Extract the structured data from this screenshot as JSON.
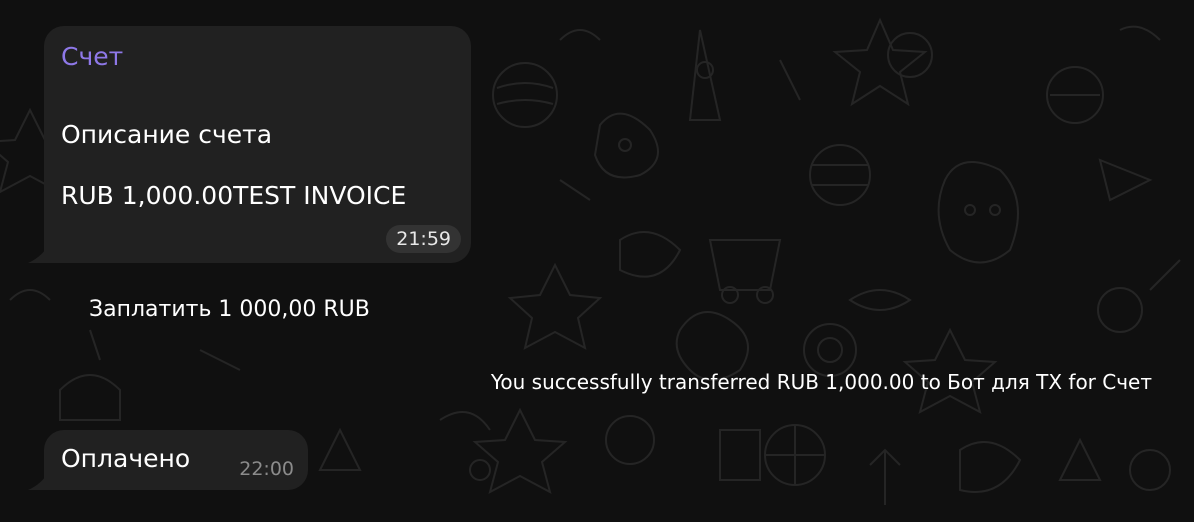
{
  "invoice": {
    "title": "Счет",
    "description": "Описание счета",
    "amount_line": "RUB 1,000.00TEST INVOICE",
    "time": "21:59"
  },
  "pay_button": {
    "label": "Заплатить 1 000,00 RUB"
  },
  "service_message": {
    "text": "You successfully transferred RUB 1,000.00 to Бот для TX for Счет"
  },
  "paid_message": {
    "text": "Оплачено",
    "time": "22:00"
  },
  "colors": {
    "background": "#101010",
    "bubble": "#212121",
    "title_accent": "#8e78e8",
    "time_chip": "#333333",
    "time_muted": "#8b8b8b"
  },
  "icons": [
    "background-doodle-pattern"
  ]
}
